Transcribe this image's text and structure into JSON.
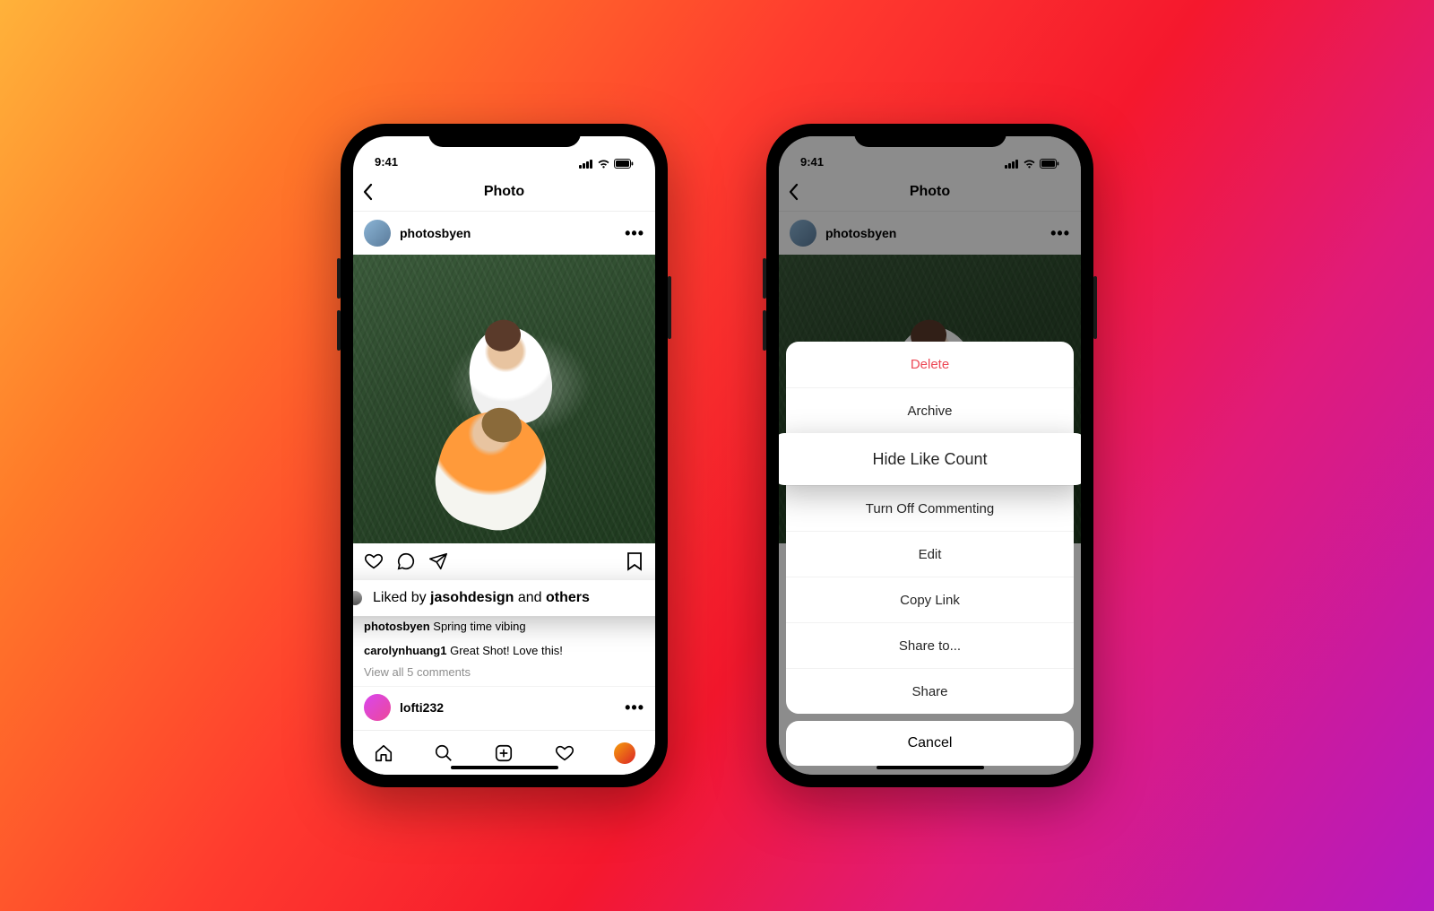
{
  "statusbar": {
    "time": "9:41"
  },
  "nav": {
    "title": "Photo"
  },
  "post": {
    "username": "photosbyen",
    "liked_by_prefix": "Liked by ",
    "liked_by_user": "jasohdesign",
    "liked_by_mid": " and ",
    "liked_by_suffix": "others",
    "caption_user": "photosbyen",
    "caption_text": " Spring time vibing",
    "comment_user": "carolynhuang1",
    "comment_text": " Great Shot! Love this!",
    "view_all": "View all 5 comments",
    "next_user": "lofti232"
  },
  "sheet": {
    "items": [
      {
        "label": "Delete",
        "red": true
      },
      {
        "label": "Archive"
      },
      {
        "label": "Hide Like Count",
        "popped": true
      },
      {
        "label": "Turn Off Commenting"
      },
      {
        "label": "Edit"
      },
      {
        "label": "Copy Link"
      },
      {
        "label": "Share to..."
      },
      {
        "label": "Share"
      }
    ],
    "cancel": "Cancel"
  }
}
